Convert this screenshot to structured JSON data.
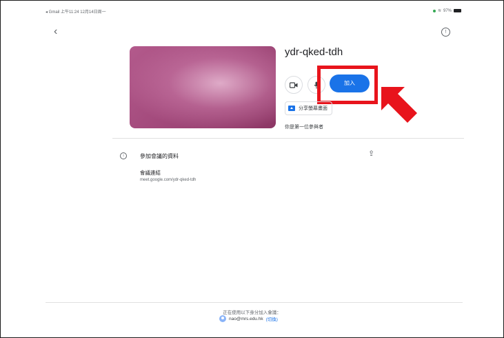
{
  "status_bar": {
    "left": "◂ Gmail  上午11:24  12月14日周一",
    "battery": "97%"
  },
  "meeting": {
    "code": "ydr-qked-tdh",
    "join_label": "加入",
    "share_label": "分享螢幕畫面",
    "first_participant_text": "你是第一位參與者"
  },
  "details": {
    "title": "參加會議的資料",
    "link_label": "會議連結",
    "link_url": "meet.google.com/ydr-qked-tdh"
  },
  "footer": {
    "using_text": "正在使用以下身分加入會議：",
    "account": "nao@mrs.edu.hk",
    "switch_label": "(切換)"
  },
  "colors": {
    "accent": "#1a73e8",
    "highlight": "#e8141c"
  }
}
